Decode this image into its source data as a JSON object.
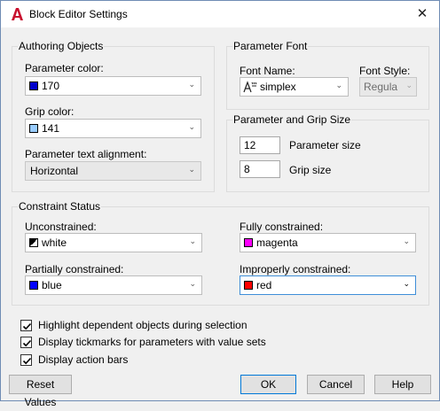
{
  "window": {
    "title": "Block Editor Settings",
    "close_glyph": "✕"
  },
  "authoring": {
    "title": "Authoring Objects",
    "param_color_label": "Parameter color:",
    "param_color_value": "170",
    "param_color_swatch": "#0000cc",
    "grip_color_label": "Grip color:",
    "grip_color_value": "141",
    "grip_color_swatch": "#99ccff",
    "text_align_label": "Parameter text alignment:",
    "text_align_value": "Horizontal"
  },
  "param_font": {
    "title": "Parameter Font",
    "font_name_label": "Font Name:",
    "font_name_value": "simplex",
    "font_icon": "shx-font-icon",
    "font_style_label": "Font Style:",
    "font_style_value": "Regula"
  },
  "size": {
    "title": "Parameter and Grip Size",
    "param_size_value": "12",
    "param_size_label": "Parameter size",
    "grip_size_value": "8",
    "grip_size_label": "Grip size"
  },
  "constraint": {
    "title": "Constraint Status",
    "unconstrained_label": "Unconstrained:",
    "unconstrained_value": "white",
    "fully_label": "Fully constrained:",
    "fully_value": "magenta",
    "fully_swatch": "#ff00ff",
    "partially_label": "Partially constrained:",
    "partially_value": "blue",
    "partially_swatch": "#0000ff",
    "improperly_label": "Improperly constrained:",
    "improperly_value": "red",
    "improperly_swatch": "#ff0000"
  },
  "options": [
    {
      "label": "Highlight dependent objects during selection",
      "checked": true
    },
    {
      "label": "Display tickmarks for parameters with value sets",
      "checked": true
    },
    {
      "label": "Display action bars",
      "checked": true
    }
  ],
  "buttons": {
    "reset": "Reset Values",
    "ok": "OK",
    "cancel": "Cancel",
    "help": "Help"
  },
  "colors": {
    "accent": "#0078d7",
    "app_icon": "#c8102e"
  }
}
